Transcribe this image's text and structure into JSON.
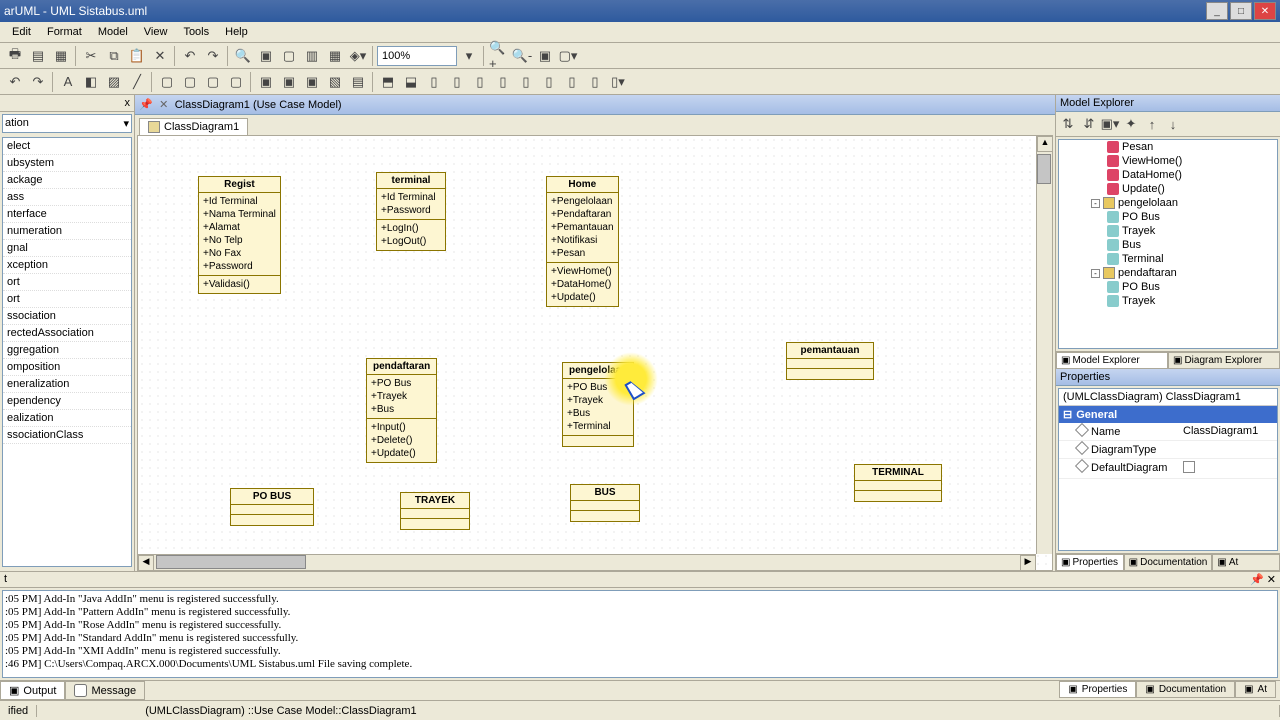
{
  "titlebar": {
    "title": "arUML - UML Sistabus.uml"
  },
  "menus": [
    "Edit",
    "Format",
    "Model",
    "View",
    "Tools",
    "Help"
  ],
  "toolbar": {
    "zoom": "100%",
    "icons": [
      "print-icon",
      "page-icon",
      "doc-icon",
      "cut-icon",
      "copy-icon",
      "paste-icon",
      "delete-icon",
      "undo-icon",
      "redo-icon",
      "find-icon",
      "zoom-in-icon",
      "zoom-out-icon",
      "fit-icon",
      "page-layout-icon"
    ]
  },
  "toolbar2_icons": [
    "undo-icon",
    "redo-icon",
    "font-icon",
    "bold-icon",
    "color-icon",
    "fill-icon",
    "line-icon",
    "layout-icon",
    "tb-a",
    "tb-b",
    "tb-c",
    "tb-d",
    "tb-e",
    "tb-f",
    "tb-g",
    "tb-h",
    "tb-i",
    "tb-j",
    "tb-k",
    "tb-l",
    "tb-m",
    "tb-n"
  ],
  "toolbox": {
    "hdr": "x",
    "section": "ation",
    "items": [
      "elect",
      "ubsystem",
      "ackage",
      "ass",
      "nterface",
      "numeration",
      "gnal",
      "xception",
      "ort",
      "ort",
      "ssociation",
      "rectedAssociation",
      "ggregation",
      "omposition",
      "eneralization",
      "ependency",
      "ealization",
      "ssociationClass"
    ]
  },
  "diagram": {
    "tab_label": "ClassDiagram1 (Use Case Model)",
    "inner_tab": "ClassDiagram1",
    "classes": {
      "regist": {
        "name": "Regist",
        "attrs": [
          "+Id Terminal",
          "+Nama Terminal",
          "+Alamat",
          "+No Telp",
          "+No Fax",
          "+Password"
        ],
        "ops": [
          "+Validasi()"
        ]
      },
      "terminal": {
        "name": "terminal",
        "attrs": [
          "+Id Terminal",
          "+Password"
        ],
        "ops": [
          "+LogIn()",
          "+LogOut()"
        ]
      },
      "home": {
        "name": "Home",
        "attrs": [
          "+Pengelolaan",
          "+Pendaftaran",
          "+Pemantauan",
          "+Notifikasi",
          "+Pesan"
        ],
        "ops": [
          "+ViewHome()",
          "+DataHome()",
          "+Update()"
        ]
      },
      "pendaftaran": {
        "name": "pendaftaran",
        "attrs": [
          "+PO Bus",
          "+Trayek",
          "+Bus"
        ],
        "ops": [
          "+Input()",
          "+Delete()",
          "+Update()"
        ]
      },
      "pengelolaan": {
        "name": "pengelolaan",
        "attrs": [
          "+PO Bus",
          "+Trayek",
          "+Bus",
          "+Terminal"
        ],
        "ops": []
      },
      "pemantauan": {
        "name": "pemantauan",
        "attrs": [],
        "ops": []
      },
      "pobus": {
        "name": "PO BUS",
        "attrs": [],
        "ops": []
      },
      "trayek": {
        "name": "TRAYEK",
        "attrs": [],
        "ops": []
      },
      "bus": {
        "name": "BUS",
        "attrs": [],
        "ops": []
      },
      "terminal2": {
        "name": "TERMINAL",
        "attrs": [],
        "ops": []
      }
    }
  },
  "model_explorer": {
    "title": "Model Explorer",
    "items": [
      {
        "indent": 3,
        "type": "op",
        "label": "Pesan"
      },
      {
        "indent": 3,
        "type": "op",
        "label": "ViewHome()"
      },
      {
        "indent": 3,
        "type": "op",
        "label": "DataHome()"
      },
      {
        "indent": 3,
        "type": "op",
        "label": "Update()"
      },
      {
        "indent": 2,
        "type": "pkg",
        "label": "pengelolaan",
        "exp": "-"
      },
      {
        "indent": 3,
        "type": "cls",
        "label": "PO Bus"
      },
      {
        "indent": 3,
        "type": "cls",
        "label": "Trayek"
      },
      {
        "indent": 3,
        "type": "cls",
        "label": "Bus"
      },
      {
        "indent": 3,
        "type": "cls",
        "label": "Terminal"
      },
      {
        "indent": 2,
        "type": "pkg",
        "label": "pendaftaran",
        "exp": "-"
      },
      {
        "indent": 3,
        "type": "cls",
        "label": "PO Bus"
      },
      {
        "indent": 3,
        "type": "cls",
        "label": "Trayek"
      }
    ],
    "tabs": [
      "Model Explorer",
      "Diagram Explorer"
    ]
  },
  "properties": {
    "title": "Properties",
    "object": "(UMLClassDiagram) ClassDiagram1",
    "group": "General",
    "rows": [
      {
        "k": "Name",
        "v": "ClassDiagram1"
      },
      {
        "k": "DiagramType",
        "v": ""
      },
      {
        "k": "DefaultDiagram",
        "v": "[checkbox]"
      }
    ],
    "tabs": [
      "Properties",
      "Documentation",
      "At"
    ]
  },
  "output": {
    "hdr": "t",
    "lines": [
      ":05 PM]  Add-In \"Java AddIn\" menu is registered successfully.",
      ":05 PM]  Add-In \"Pattern AddIn\" menu is registered successfully.",
      ":05 PM]  Add-In \"Rose AddIn\" menu is registered successfully.",
      ":05 PM]  Add-In \"Standard AddIn\" menu is registered successfully.",
      ":05 PM]  Add-In \"XMI AddIn\" menu is registered successfully.",
      ":46 PM]  C:\\Users\\Compaq.ARCX.000\\Documents\\UML Sistabus.uml File saving complete."
    ],
    "tabs": [
      "Output",
      "Message"
    ]
  },
  "statusbar": {
    "left": "ified",
    "path": "(UMLClassDiagram) ::Use Case Model::ClassDiagram1"
  }
}
